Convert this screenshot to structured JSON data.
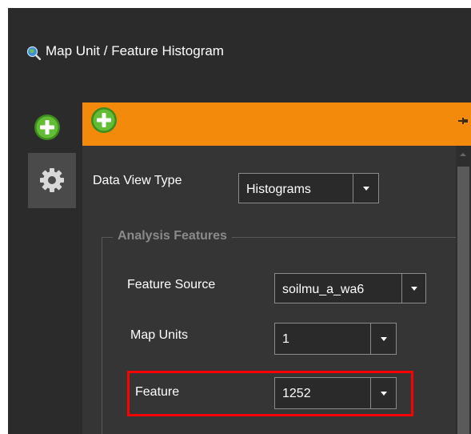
{
  "window": {
    "title": "Map Unit / Feature Histogram",
    "accent_color": "#f48a0c",
    "highlight_color": "#ff0000"
  },
  "icons": {
    "app": "magnifier-globe-icon",
    "add": "plus-icon",
    "settings": "gear-icon",
    "pin": "pin-icon"
  },
  "panel": {
    "data_view_type_label": "Data View Type",
    "data_view_type_value": "Histograms",
    "group_title": "Analysis Features",
    "feature_source_label": "Feature Source",
    "feature_source_value": "soilmu_a_wa6",
    "map_units_label": "Map Units",
    "map_units_value": "1",
    "feature_label": "Feature",
    "feature_value": "1252"
  }
}
